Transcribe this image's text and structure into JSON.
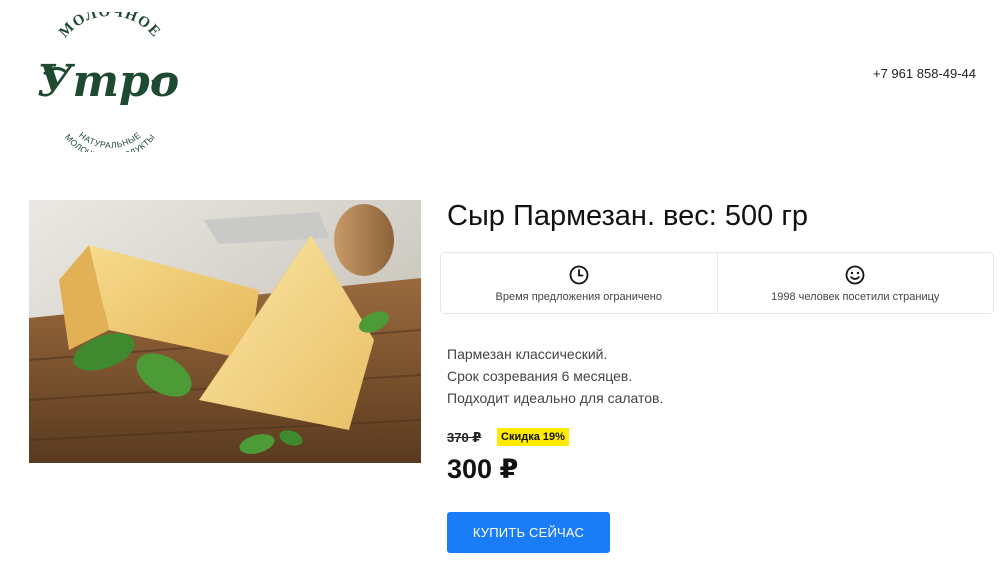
{
  "header": {
    "logo": {
      "arc_top": "МОЛОЧНОЕ",
      "script": "Утро",
      "arc_bottom_line1": "НАТУРАЛЬНЫЕ",
      "arc_bottom_line2": "МОЛОЧНЫЕ ПРОДУКТЫ",
      "color": "#1f4a32"
    },
    "phone": "+7 961 858-49-44"
  },
  "product": {
    "image_icon": "parmesan-cheese-photo",
    "title": "Сыр Пармезан. вес: 500 гр",
    "info": [
      {
        "icon": "clock-icon",
        "text": "Время предложения ограничено"
      },
      {
        "icon": "smiley-icon",
        "text": "1998 человек посетили страницу"
      }
    ],
    "description": [
      "Пармезан классический.",
      "Срок созревания 6 месяцев.",
      "Подходит идеально для салатов."
    ],
    "old_price": "370 ₽",
    "discount": "Скидка 19%",
    "price": "300 ₽",
    "buy_label": "КУПИТЬ СЕЙЧАС"
  },
  "colors": {
    "accent": "#1a7cf6",
    "badge": "#ffea00",
    "logo_green": "#1f4a32"
  }
}
